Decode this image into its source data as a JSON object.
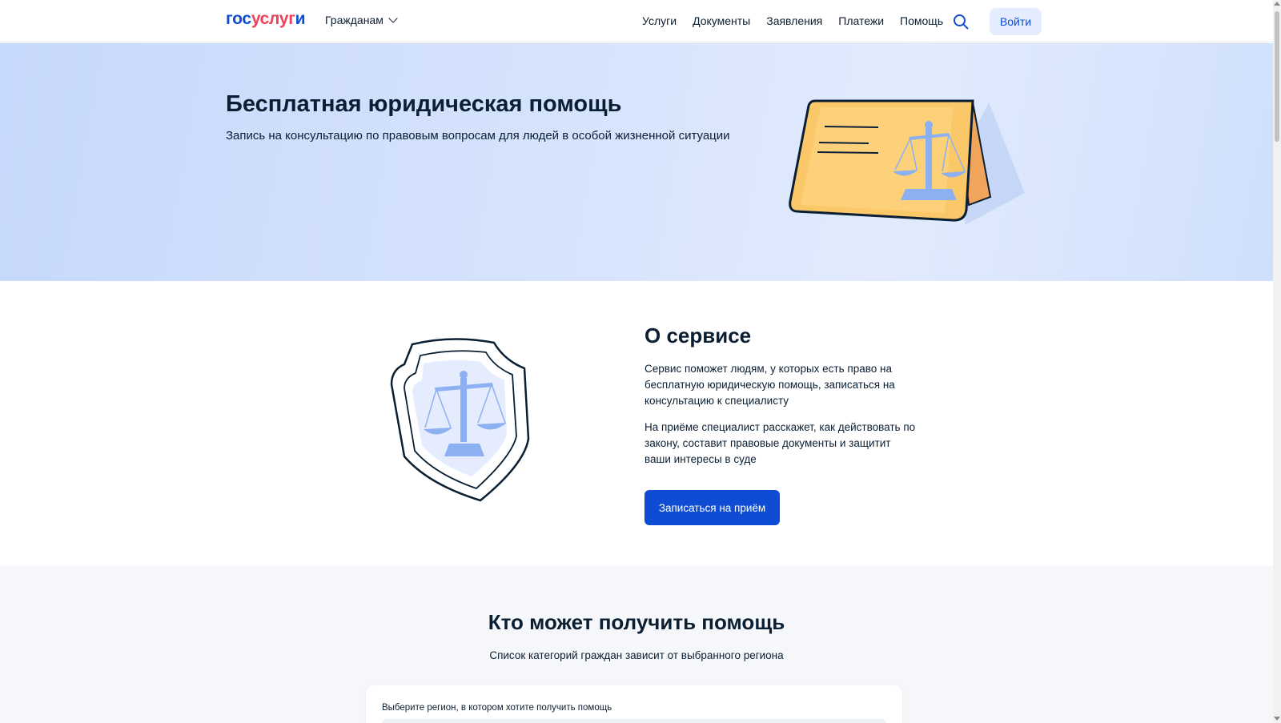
{
  "header": {
    "logo": {
      "part1": "гос",
      "part2": "услуг",
      "part3": "и"
    },
    "audience_label": "Гражданам",
    "nav": [
      "Услуги",
      "Документы",
      "Заявления",
      "Платежи",
      "Помощь"
    ],
    "search_icon": "search-icon",
    "login_label": "Войти"
  },
  "hero": {
    "title": "Бесплатная юридическая помощь",
    "subtitle": "Запись на консультацию по правовым вопросам для людей в особой жизненной ситуации",
    "illustration": "scales-card-illustration"
  },
  "about": {
    "title": "О сервисе",
    "paragraph1": "Сервис поможет людям, у которых есть право на бесплатную юридическую помощь, записаться на консультацию к специалисту",
    "paragraph2": "На приёме специалист расскажет, как действовать по закону, составит правовые документы и защитит ваши интересы в суде",
    "cta_label": "Записаться на приём",
    "illustration": "shield-scales-illustration"
  },
  "who": {
    "title": "Кто может получить помощь",
    "subtitle": "Список категорий граждан зависит от выбранного региона",
    "region_label": "Выберите регион, в котором хотите получить помощь"
  },
  "colors": {
    "brand_blue": "#0d4cd3",
    "brand_red": "#ee3f58",
    "text": "#0b1f33",
    "hero_bg": "#d6e3fc"
  }
}
